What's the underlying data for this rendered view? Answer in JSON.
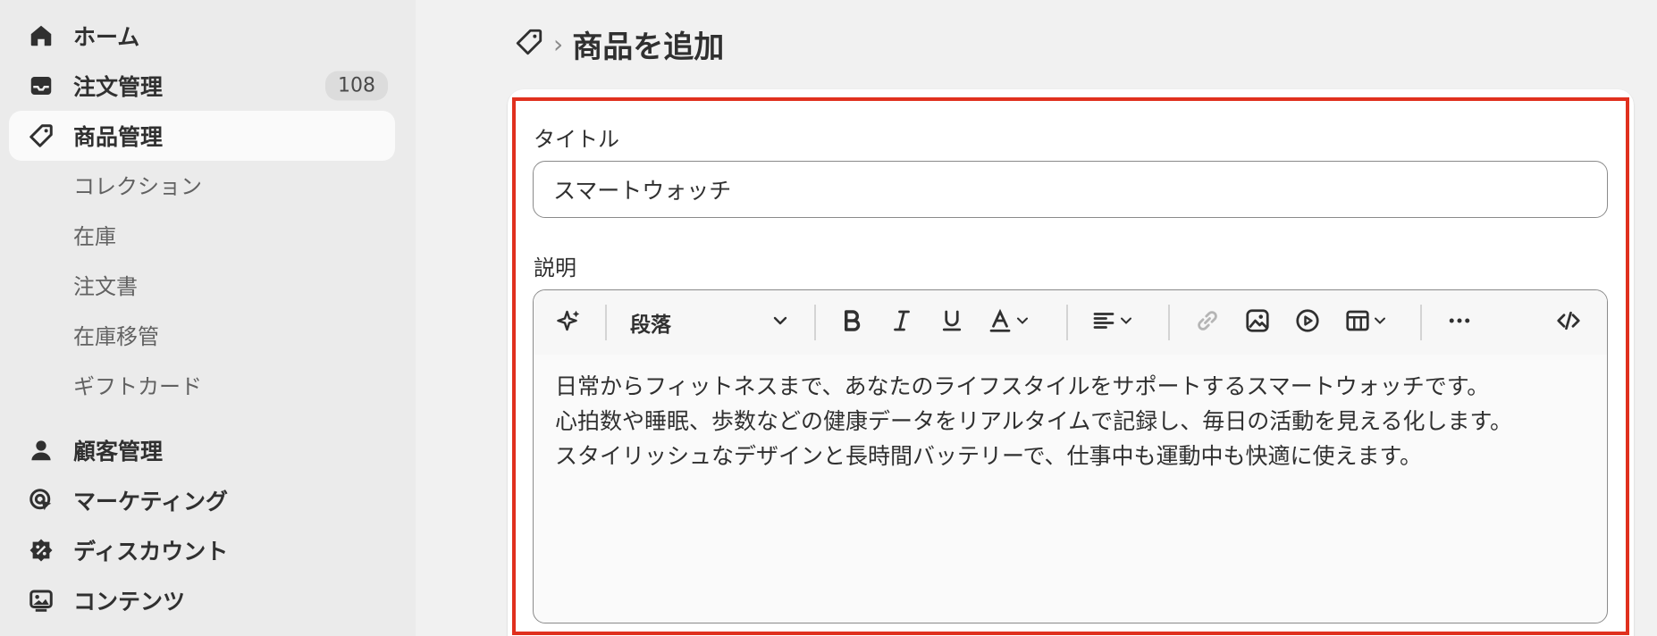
{
  "sidebar": {
    "items": [
      {
        "label": "ホーム",
        "icon": "home-icon"
      },
      {
        "label": "注文管理",
        "icon": "inbox-icon",
        "badge": "108"
      },
      {
        "label": "商品管理",
        "icon": "tag-icon",
        "active": true
      },
      {
        "label": "顧客管理",
        "icon": "person-icon"
      },
      {
        "label": "マーケティング",
        "icon": "target-icon"
      },
      {
        "label": "ディスカウント",
        "icon": "discount-icon"
      },
      {
        "label": "コンテンツ",
        "icon": "content-icon"
      }
    ],
    "sub_items": [
      "コレクション",
      "在庫",
      "注文書",
      "在庫移管",
      "ギフトカード"
    ]
  },
  "header": {
    "breadcrumb_icon": "tag-icon",
    "title": "商品を追加"
  },
  "form": {
    "title_label": "タイトル",
    "title_value": "スマートウォッチ",
    "description_label": "説明",
    "toolbar": {
      "paragraph_select": "段落"
    },
    "description_lines": [
      "日常からフィットネスまで、あなたのライフスタイルをサポートするスマートウォッチです。",
      "心拍数や睡眠、歩数などの健康データをリアルタイムで記録し、毎日の活動を見える化します。",
      "スタイリッシュなデザインと長時間バッテリーで、仕事中も運動中も快適に使えます。"
    ]
  },
  "colors": {
    "highlight": "#e0301e",
    "sidebar_bg": "#ebebeb",
    "page_bg": "#f1f1f1"
  }
}
